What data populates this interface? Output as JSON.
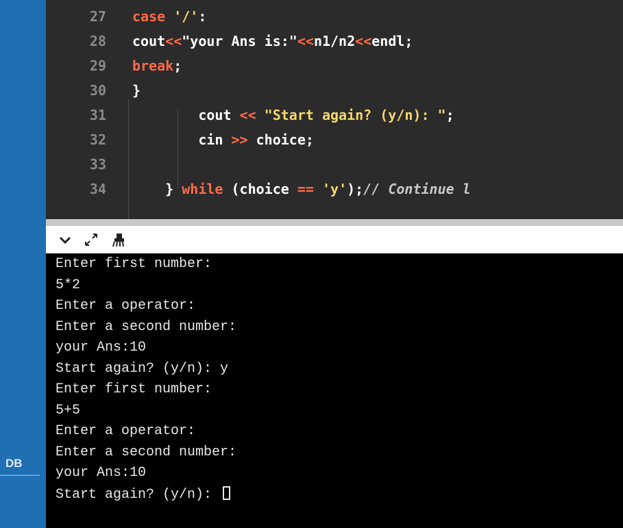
{
  "sidebar": {
    "label": "DB"
  },
  "editor": {
    "lines": [
      {
        "num": "27",
        "tokens": [
          {
            "t": "case ",
            "c": "kw"
          },
          {
            "t": "'/'",
            "c": "str"
          },
          {
            "t": ":",
            "c": "tx"
          }
        ]
      },
      {
        "num": "28",
        "tokens": [
          {
            "t": "cout",
            "c": "tx"
          },
          {
            "t": "<<",
            "c": "op"
          },
          {
            "t": "\"your Ans is:\"",
            "c": "tx"
          },
          {
            "t": "<<",
            "c": "op"
          },
          {
            "t": "n1/n2",
            "c": "tx"
          },
          {
            "t": "<<",
            "c": "op"
          },
          {
            "t": "endl;",
            "c": "tx"
          }
        ]
      },
      {
        "num": "29",
        "tokens": [
          {
            "t": "break",
            "c": "kw"
          },
          {
            "t": ";",
            "c": "tx"
          }
        ]
      },
      {
        "num": "30",
        "tokens": [
          {
            "t": "}",
            "c": "tx"
          }
        ]
      },
      {
        "num": "31",
        "tokens": [
          {
            "t": "        cout ",
            "c": "tx"
          },
          {
            "t": "<<",
            "c": "op"
          },
          {
            "t": " \"Start again? (y/n): \"",
            "c": "str"
          },
          {
            "t": ";",
            "c": "tx"
          }
        ]
      },
      {
        "num": "32",
        "tokens": [
          {
            "t": "        cin ",
            "c": "tx"
          },
          {
            "t": ">>",
            "c": "op"
          },
          {
            "t": " choice;",
            "c": "tx"
          }
        ]
      },
      {
        "num": "33",
        "tokens": []
      },
      {
        "num": "34",
        "tokens": [
          {
            "t": "    } ",
            "c": "tx"
          },
          {
            "t": "while",
            "c": "kw"
          },
          {
            "t": " (choice ",
            "c": "tx"
          },
          {
            "t": "==",
            "c": "op"
          },
          {
            "t": " ",
            "c": "tx"
          },
          {
            "t": "'y'",
            "c": "str"
          },
          {
            "t": ");",
            "c": "tx"
          },
          {
            "t": "// Continue l",
            "c": "cmt"
          }
        ]
      }
    ]
  },
  "toolbar": {
    "icons": [
      "chevron-down-icon",
      "expand-icon",
      "clear-console-icon"
    ]
  },
  "console": {
    "lines": [
      "Enter first number:",
      "5*2",
      "Enter a operator:",
      "Enter a second number:",
      "your Ans:10",
      "Start again? (y/n): y",
      "Enter first number:",
      "5+5",
      "Enter a operator:",
      "Enter a second number:",
      "your Ans:10",
      "Start again? (y/n): "
    ]
  }
}
